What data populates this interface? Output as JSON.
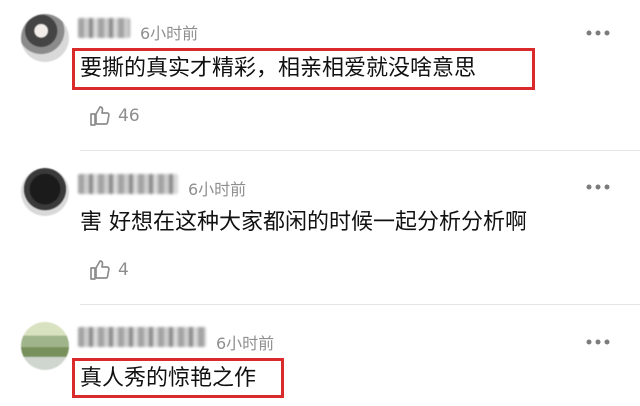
{
  "comments": [
    {
      "time": "6小时前",
      "text": "要撕的真实才精彩，相亲相爱就没啥意思",
      "likes": "46"
    },
    {
      "time": "6小时前",
      "text": "害 好想在这种大家都闲的时候一起分析分析啊",
      "likes": "4"
    },
    {
      "time": "6小时前",
      "text": "真人秀的惊艳之作"
    }
  ],
  "icons": {
    "like": "thumbs-up-icon",
    "more": "more-dots-icon"
  },
  "colors": {
    "highlight": "#d92b2b",
    "meta_text": "#8f8f8f",
    "body_text": "#111111"
  }
}
